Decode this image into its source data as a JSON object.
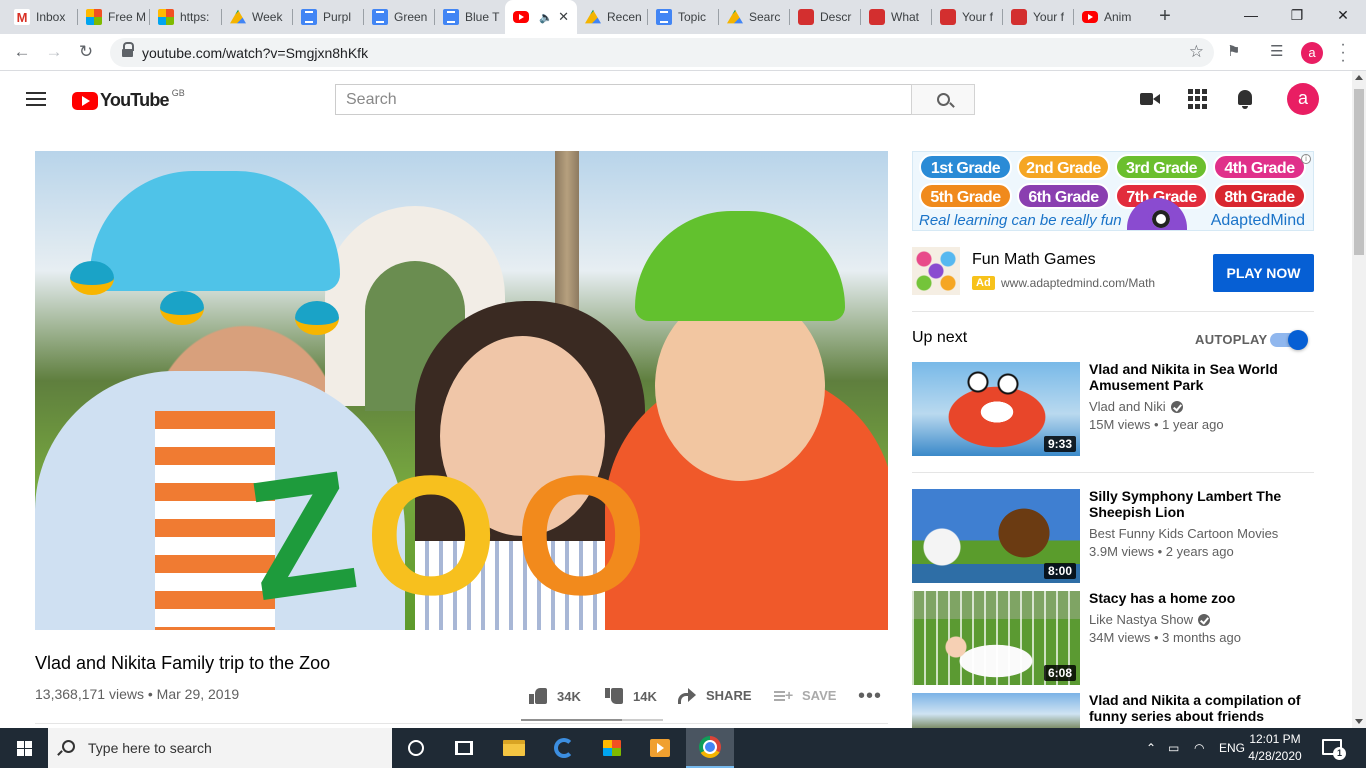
{
  "browser": {
    "tabs": [
      {
        "label": "Inbox",
        "icon": "gmail-icon"
      },
      {
        "label": "Free M",
        "icon": "microsoft-icon"
      },
      {
        "label": "https:",
        "icon": "microsoft-icon"
      },
      {
        "label": "Week",
        "icon": "google-drive-icon"
      },
      {
        "label": "Purpl",
        "icon": "google-docs-icon"
      },
      {
        "label": "Green",
        "icon": "google-docs-icon"
      },
      {
        "label": "Blue T",
        "icon": "google-docs-icon"
      },
      {
        "label": "",
        "icon": "youtube-icon",
        "active": true,
        "audio": "🔈",
        "close": "✕"
      },
      {
        "label": "Recen",
        "icon": "google-drive-icon"
      },
      {
        "label": "Topic",
        "icon": "google-docs-icon"
      },
      {
        "label": "Searc",
        "icon": "google-drive-icon"
      },
      {
        "label": "Descr",
        "icon": "adobe-icon"
      },
      {
        "label": "What",
        "icon": "adobe-icon"
      },
      {
        "label": "Your f",
        "icon": "adobe-icon"
      },
      {
        "label": "Your f",
        "icon": "adobe-icon"
      },
      {
        "label": "Anim",
        "icon": "youtube-icon"
      }
    ],
    "new_tab": "+",
    "window": {
      "minimize": "—",
      "maximize": "❐",
      "close": "✕"
    },
    "url": "youtube.com/watch?v=Smgjxn8hKfk",
    "profile_letter": "a"
  },
  "youtube": {
    "logo_text": "YouTube",
    "region": "GB",
    "search_placeholder": "Search",
    "avatar_letter": "a"
  },
  "video": {
    "overlay_text": {
      "z": "Z",
      "o1": "O",
      "o2": "O"
    },
    "title": "Vlad and Nikita Family trip to the Zoo",
    "views": "13,368,171 views",
    "date": "Mar 29, 2019",
    "likes": "34K",
    "dislikes": "14K",
    "share_label": "SHARE",
    "save_label": "SAVE",
    "more": "•••",
    "like_ratio": 0.71
  },
  "ad": {
    "grades": [
      "1st Grade",
      "2nd Grade",
      "3rd Grade",
      "4th Grade",
      "5th Grade",
      "6th Grade",
      "7th Grade",
      "8th Grade"
    ],
    "tagline": "Real learning can be really fun",
    "brand": "AdaptedMind",
    "info": "i",
    "title": "Fun Math Games",
    "badge": "Ad",
    "url": "www.adaptedmind.com/Math",
    "cta": "PLAY NOW"
  },
  "sidebar": {
    "up_next": "Up next",
    "autoplay_label": "AUTOPLAY",
    "autoplay_on": true,
    "items": [
      {
        "title_l1": "Vlad and Nikita in Sea World",
        "title_l2": "Amusement Park",
        "channel": "Vlad and Niki",
        "verified": true,
        "meta": "15M views • 1 year ago",
        "duration": "9:33"
      },
      {
        "title_l1": "Silly Symphony Lambert The",
        "title_l2": "Sheepish Lion",
        "channel": "Best Funny Kids Cartoon Movies",
        "verified": false,
        "meta": "3.9M views • 2 years ago",
        "duration": "8:00"
      },
      {
        "title_l1": "Stacy has a home zoo",
        "title_l2": "",
        "channel": "Like Nastya Show",
        "verified": true,
        "meta": "34M views • 3 months ago",
        "duration": "6:08"
      },
      {
        "title_l1": "Vlad and Nikita a compilation of",
        "title_l2": "funny series about friends",
        "channel": "",
        "verified": false,
        "meta": "",
        "duration": ""
      }
    ]
  },
  "taskbar": {
    "search_placeholder": "Type here to search",
    "language": "ENG",
    "time": "12:01 PM",
    "date": "4/28/2020",
    "notifications": "1"
  }
}
